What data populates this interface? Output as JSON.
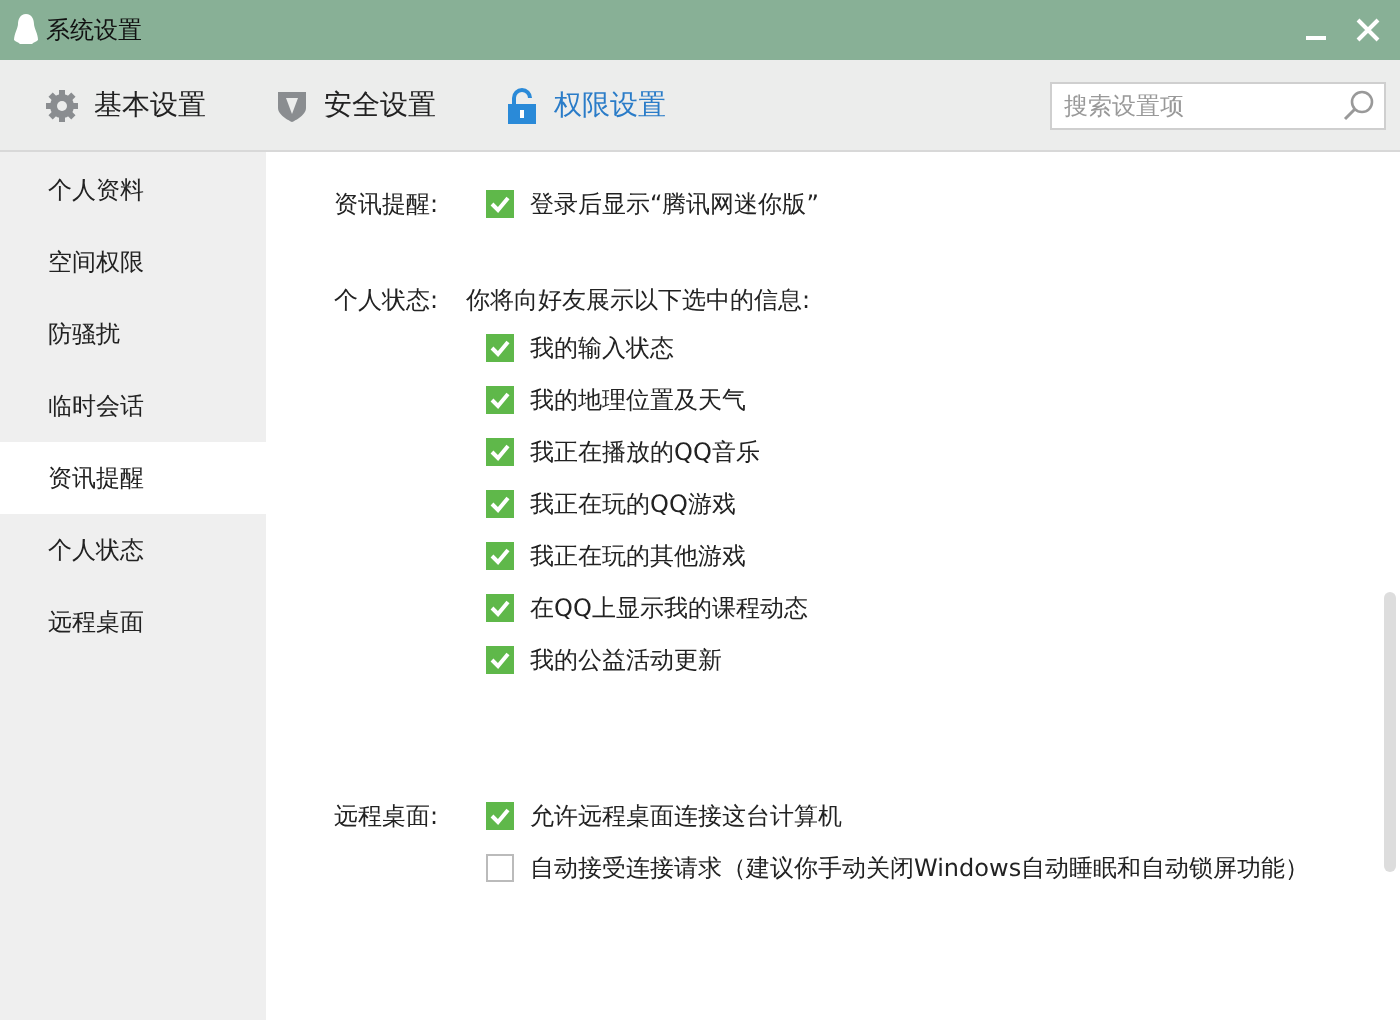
{
  "window": {
    "title": "系统设置"
  },
  "tabs": [
    {
      "label": "基本设置",
      "selected": false
    },
    {
      "label": "安全设置",
      "selected": false
    },
    {
      "label": "权限设置",
      "selected": true
    }
  ],
  "search": {
    "placeholder": "搜索设置项"
  },
  "sidebar": {
    "items": [
      {
        "label": "个人资料",
        "selected": false
      },
      {
        "label": "空间权限",
        "selected": false
      },
      {
        "label": "防骚扰",
        "selected": false
      },
      {
        "label": "临时会话",
        "selected": false
      },
      {
        "label": "资讯提醒",
        "selected": true
      },
      {
        "label": "个人状态",
        "selected": false
      },
      {
        "label": "远程桌面",
        "selected": false
      }
    ]
  },
  "sections": [
    {
      "label": "资讯提醒:",
      "options": [
        {
          "label": "登录后显示“腾讯网迷你版”",
          "checked": true
        }
      ]
    },
    {
      "label": "个人状态:",
      "description": "你将向好友展示以下选中的信息:",
      "options": [
        {
          "label": "我的输入状态",
          "checked": true
        },
        {
          "label": "我的地理位置及天气",
          "checked": true
        },
        {
          "label": "我正在播放的QQ音乐",
          "checked": true
        },
        {
          "label": "我正在玩的QQ游戏",
          "checked": true
        },
        {
          "label": "我正在玩的其他游戏",
          "checked": true
        },
        {
          "label": "在QQ上显示我的课程动态",
          "checked": true
        },
        {
          "label": "我的公益活动更新",
          "checked": true
        }
      ]
    },
    {
      "label": "远程桌面:",
      "options": [
        {
          "label": "允许远程桌面连接这台计算机",
          "checked": true
        },
        {
          "label": "自动接受连接请求（建议你手动关闭Windows自动睡眠和自动锁屏功能）",
          "checked": false
        }
      ]
    }
  ]
}
